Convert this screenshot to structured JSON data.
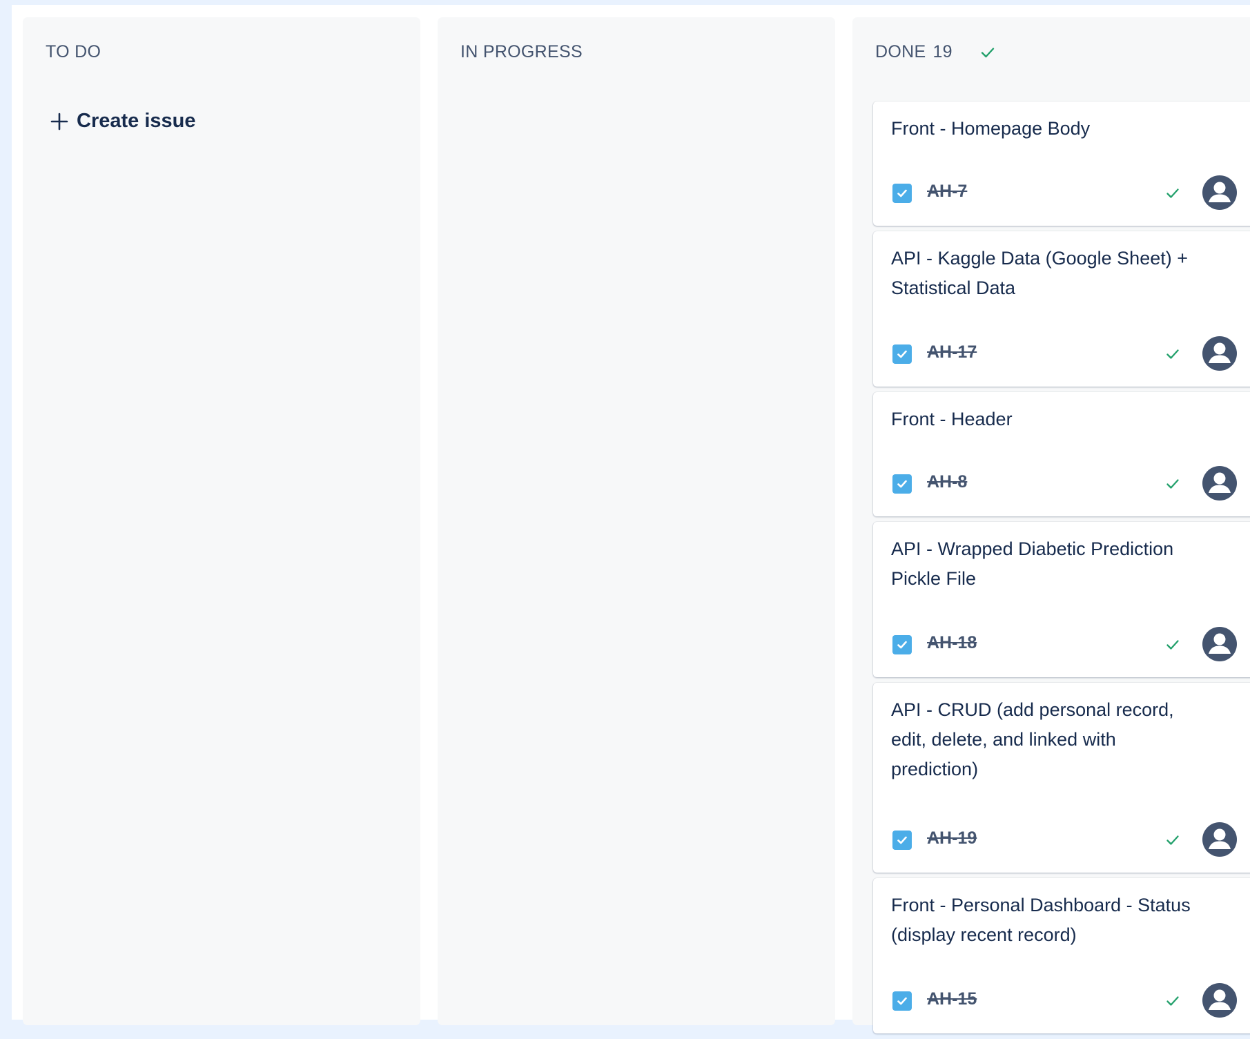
{
  "columns": {
    "todo": {
      "title": "TO DO",
      "create_label": "Create issue"
    },
    "in_progress": {
      "title": "IN PROGRESS"
    },
    "done": {
      "title": "DONE",
      "count": "19"
    }
  },
  "cards": [
    {
      "title": "Front - Homepage Body",
      "key": "AH-7"
    },
    {
      "title": "API - Kaggle Data (Google Sheet) + Statistical Data",
      "key": "AH-17"
    },
    {
      "title": "Front - Header",
      "key": "AH-8"
    },
    {
      "title": "API - Wrapped Diabetic Prediction Pickle File",
      "key": "AH-18"
    },
    {
      "title": "API - CRUD (add personal record, edit, delete, and linked with prediction)",
      "key": "AH-19"
    },
    {
      "title": "Front - Personal Dashboard - Status (display recent record)",
      "key": "AH-15"
    }
  ],
  "colors": {
    "accent": "#4bade8",
    "done_check": "#22a06b",
    "text": "#172b4d",
    "subtle_text": "#44546f",
    "avatar": "#44546f"
  },
  "icons": {
    "create": "plus-icon",
    "done": "check-icon",
    "task": "task-checkbox-icon",
    "assignee": "user-avatar-icon"
  }
}
